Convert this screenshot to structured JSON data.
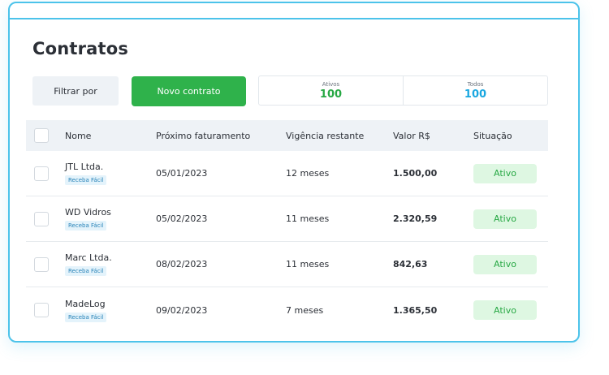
{
  "page": {
    "title": "Contratos"
  },
  "toolbar": {
    "filter_label": "Filtrar por",
    "new_label": "Novo contrato"
  },
  "summary": {
    "active": {
      "label": "Ativos",
      "value": "100"
    },
    "all": {
      "label": "Todos",
      "value": "100"
    }
  },
  "table": {
    "columns": [
      "Nome",
      "Próximo faturamento",
      "Vigência restante",
      "Valor R$",
      "Situação"
    ],
    "rows": [
      {
        "name": "JTL Ltda.",
        "tag": "Receba Fácil",
        "next_billing": "05/01/2023",
        "remaining": "12 meses",
        "value": "1.500,00",
        "status": "Ativo"
      },
      {
        "name": "WD Vidros",
        "tag": "Receba Fácil",
        "next_billing": "05/02/2023",
        "remaining": "11 meses",
        "value": "2.320,59",
        "status": "Ativo"
      },
      {
        "name": "Marc Ltda.",
        "tag": "Receba Fácil",
        "next_billing": "08/02/2023",
        "remaining": "11 meses",
        "value": "842,63",
        "status": "Ativo"
      },
      {
        "name": "MadeLog",
        "tag": "Receba Fácil",
        "next_billing": "09/02/2023",
        "remaining": "7 meses",
        "value": "1.365,50",
        "status": "Ativo"
      }
    ]
  },
  "colors": {
    "accent_border": "#4cc3ea",
    "primary_button": "#2fb24b",
    "active_value": "#27a844",
    "all_value": "#1aa7e0",
    "status_bg": "#def7e2"
  }
}
